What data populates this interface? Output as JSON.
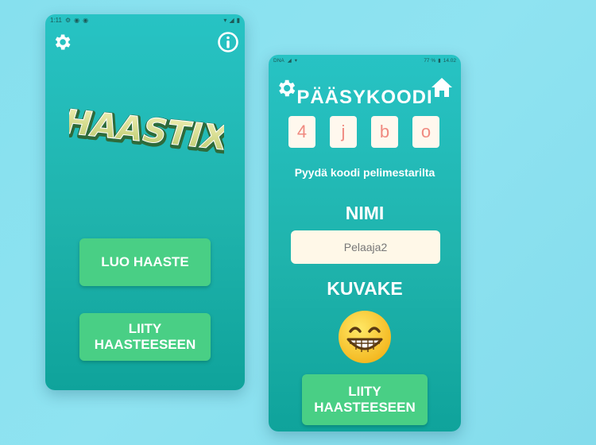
{
  "screen1": {
    "status": {
      "time": "1:11"
    },
    "logo_text": "HAASTIX",
    "buttons": {
      "create": "LUO HAASTE",
      "join_line1": "LIITY",
      "join_line2": "HAASTEESEEN"
    },
    "icons": {
      "settings": "gear-icon",
      "info": "info-icon"
    }
  },
  "screen2": {
    "status": {
      "time": "14.02",
      "battery": "77 %",
      "carrier": "DNA"
    },
    "title": "PÄÄSYKOODI",
    "code": [
      "4",
      "j",
      "b",
      "o"
    ],
    "hint": "Pyydä koodi pelimestarilta",
    "name_label": "NIMI",
    "name_value": "Pelaaja2",
    "avatar_label": "KUVAKE",
    "avatar": "grinning-face-icon",
    "buttons": {
      "join_line1": "LIITY",
      "join_line2": "HAASTEESEEN"
    },
    "icons": {
      "settings": "gear-icon",
      "home": "home-icon"
    }
  },
  "colors": {
    "button": "#49cf85",
    "phone_top": "#27c3c4",
    "phone_bottom": "#0fa39b",
    "code_text": "#f08a80"
  }
}
